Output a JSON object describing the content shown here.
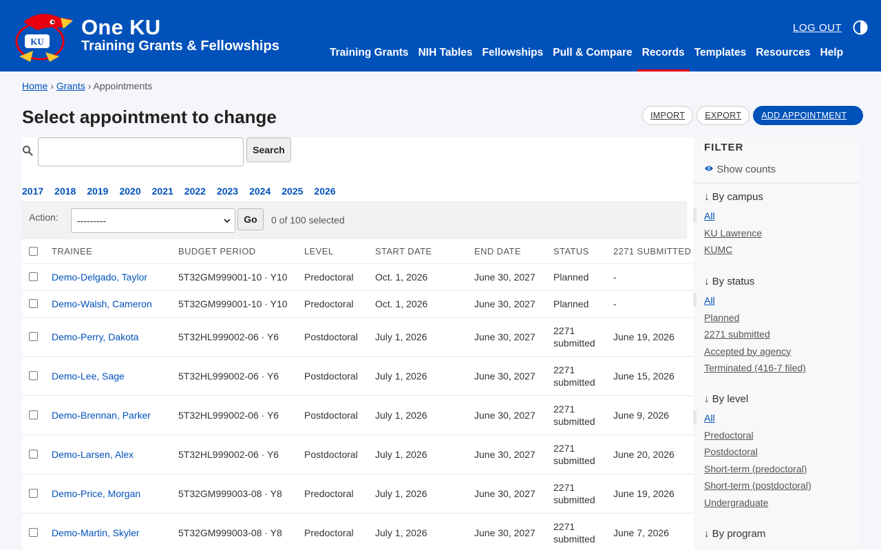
{
  "brand": {
    "title": "One KU",
    "subtitle": "Training Grants & Fellowships"
  },
  "header": {
    "logout_label": "LOG OUT",
    "contrast_icon": "half-circle-contrast-icon"
  },
  "nav": [
    {
      "label": "Training Grants"
    },
    {
      "label": "NIH Tables"
    },
    {
      "label": "Fellowships"
    },
    {
      "label": "Pull & Compare"
    },
    {
      "label": "Records",
      "active": true
    },
    {
      "label": "Templates"
    },
    {
      "label": "Resources"
    },
    {
      "label": "Help"
    }
  ],
  "breadcrumb": {
    "home": "Home",
    "grants": "Grants",
    "sep": "›",
    "current": "Appointments"
  },
  "page": {
    "title": "Select appointment to change"
  },
  "tools": {
    "import": "IMPORT",
    "export": "EXPORT",
    "add": "ADD APPOINTMENT"
  },
  "search": {
    "button": "Search",
    "value": ""
  },
  "years": [
    "2017",
    "2018",
    "2019",
    "2020",
    "2021",
    "2022",
    "2023",
    "2024",
    "2025",
    "2026"
  ],
  "actions": {
    "label": "Action:",
    "selected": "---------",
    "go": "Go",
    "count": "0 of 100 selected"
  },
  "table": {
    "headers": [
      "TRAINEE",
      "BUDGET PERIOD",
      "LEVEL",
      "START DATE",
      "END DATE",
      "STATUS",
      "2271 SUBMITTED"
    ],
    "rows": [
      {
        "trainee": "Demo-Delgado, Taylor",
        "budget": "5T32GM999001-10 · Y10",
        "level": "Predoctoral",
        "start": "Oct. 1, 2026",
        "end": "June 30, 2027",
        "status": "Planned",
        "submitted": "-"
      },
      {
        "trainee": "Demo-Walsh, Cameron",
        "budget": "5T32GM999001-10 · Y10",
        "level": "Predoctoral",
        "start": "Oct. 1, 2026",
        "end": "June 30, 2027",
        "status": "Planned",
        "submitted": "-"
      },
      {
        "trainee": "Demo-Perry, Dakota",
        "budget": "5T32HL999002-06 · Y6",
        "level": "Postdoctoral",
        "start": "July 1, 2026",
        "end": "June 30, 2027",
        "status": "2271 submitted",
        "submitted": "June 19, 2026"
      },
      {
        "trainee": "Demo-Lee, Sage",
        "budget": "5T32HL999002-06 · Y6",
        "level": "Postdoctoral",
        "start": "July 1, 2026",
        "end": "June 30, 2027",
        "status": "2271 submitted",
        "submitted": "June 15, 2026"
      },
      {
        "trainee": "Demo-Brennan, Parker",
        "budget": "5T32HL999002-06 · Y6",
        "level": "Postdoctoral",
        "start": "July 1, 2026",
        "end": "June 30, 2027",
        "status": "2271 submitted",
        "submitted": "June 9, 2026"
      },
      {
        "trainee": "Demo-Larsen, Alex",
        "budget": "5T32HL999002-06 · Y6",
        "level": "Postdoctoral",
        "start": "July 1, 2026",
        "end": "June 30, 2027",
        "status": "2271 submitted",
        "submitted": "June 20, 2026"
      },
      {
        "trainee": "Demo-Price, Morgan",
        "budget": "5T32GM999003-08 · Y8",
        "level": "Predoctoral",
        "start": "July 1, 2026",
        "end": "June 30, 2027",
        "status": "2271 submitted",
        "submitted": "June 19, 2026"
      },
      {
        "trainee": "Demo-Martin, Skyler",
        "budget": "5T32GM999003-08 · Y8",
        "level": "Predoctoral",
        "start": "July 1, 2026",
        "end": "June 30, 2027",
        "status": "2271 submitted",
        "submitted": "June 7, 2026"
      }
    ]
  },
  "filter": {
    "title": "FILTER",
    "show_counts": "Show counts",
    "groups": [
      {
        "heading": "By campus",
        "items": [
          "All",
          "KU Lawrence",
          "KUMC"
        ]
      },
      {
        "heading": "By status",
        "items": [
          "All",
          "Planned",
          "2271 submitted",
          "Accepted by agency",
          "Terminated (416-7 filed)"
        ]
      },
      {
        "heading": "By level",
        "items": [
          "All",
          "Predoctoral",
          "Postdoctoral",
          "Short-term (predoctoral)",
          "Short-term (postdoctoral)",
          "Undergraduate"
        ]
      },
      {
        "heading": "By program",
        "items": []
      }
    ]
  },
  "colors": {
    "brand_blue": "#0051ba",
    "accent_red": "#e8000d",
    "link": "#0051ba"
  }
}
